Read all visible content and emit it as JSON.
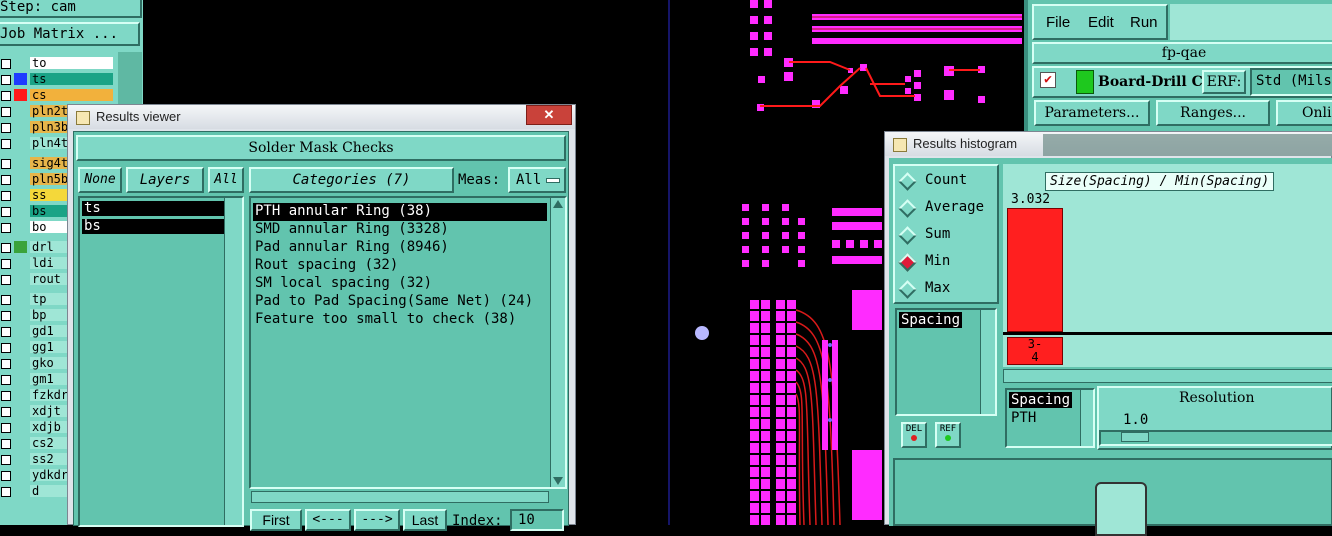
{
  "step_label": "Step: cam",
  "job_matrix_button": "Job Matrix ...",
  "layers": [
    {
      "name": "to",
      "color": "#ffffff",
      "swatch": ""
    },
    {
      "name": "ts",
      "color": "#1aa386",
      "swatch": "#1f3cff"
    },
    {
      "name": "cs",
      "color": "#f2b13c",
      "swatch": "#ff1a1a"
    },
    {
      "name": "pln2t",
      "color": "#e6b54a",
      "swatch": ""
    },
    {
      "name": "pln3b",
      "color": "#e6b54a",
      "swatch": ""
    },
    {
      "name": "pln4t",
      "color": "#9fe6d6",
      "swatch": ""
    },
    {
      "name": "sig4t",
      "color": "#e6b54a",
      "swatch": ""
    },
    {
      "name": "pln5b",
      "color": "#e6b54a",
      "swatch": ""
    },
    {
      "name": "ss",
      "color": "#f4d83a",
      "swatch": ""
    },
    {
      "name": "bs",
      "color": "#1aa386",
      "swatch": ""
    },
    {
      "name": "bo",
      "color": "#ffffff",
      "swatch": ""
    },
    {
      "name": "drl",
      "color": "#9fe6d6",
      "swatch": "#3aa33a"
    },
    {
      "name": "ldi",
      "color": "#9fe6d6",
      "swatch": ""
    },
    {
      "name": "rout",
      "color": "#9fe6d6",
      "swatch": ""
    },
    {
      "name": "tp",
      "color": "#9fe6d6",
      "swatch": ""
    },
    {
      "name": "bp",
      "color": "#9fe6d6",
      "swatch": ""
    },
    {
      "name": "gd1",
      "color": "#9fe6d6",
      "swatch": ""
    },
    {
      "name": "gg1",
      "color": "#9fe6d6",
      "swatch": ""
    },
    {
      "name": "gko",
      "color": "#9fe6d6",
      "swatch": ""
    },
    {
      "name": "gm1",
      "color": "#9fe6d6",
      "swatch": ""
    },
    {
      "name": "fzkdr",
      "color": "#9fe6d6",
      "swatch": ""
    },
    {
      "name": "xdjt",
      "color": "#9fe6d6",
      "swatch": ""
    },
    {
      "name": "xdjb",
      "color": "#9fe6d6",
      "swatch": ""
    },
    {
      "name": "cs2",
      "color": "#9fe6d6",
      "swatch": ""
    },
    {
      "name": "ss2",
      "color": "#9fe6d6",
      "swatch": ""
    },
    {
      "name": "ydkdr",
      "color": "#9fe6d6",
      "swatch": ""
    },
    {
      "name": "d",
      "color": "#9fe6d6",
      "swatch": ""
    }
  ],
  "results_viewer": {
    "title": "Results viewer",
    "heading": "Solder Mask Checks",
    "none_btn": "None",
    "layers_btn": "Layers",
    "all_btn": "All",
    "categories_btn": "Categories (7)",
    "meas_label": "Meas:",
    "meas_value": "All",
    "layer_list": [
      "ts",
      "bs"
    ],
    "categories": [
      "PTH annular Ring (38)",
      "SMD annular Ring (3328)",
      "Pad annular Ring (8946)",
      "Rout spacing (32)",
      "SM local spacing (32)",
      "Pad to Pad Spacing(Same Net) (24)",
      "Feature too small to check (38)"
    ],
    "first_btn": "First",
    "prev_btn": "<---",
    "next_btn": "--->",
    "last_btn": "Last",
    "index_label": "Index:",
    "index_value": "10"
  },
  "qae": {
    "menu": [
      "File",
      "Edit",
      "Run"
    ],
    "title": "fp-qae",
    "check_name": "Board-Drill Che",
    "erf_label": "ERF:",
    "erf_value": "Std (Mils",
    "parameters_btn": "Parameters...",
    "ranges_btn": "Ranges...",
    "online_btn": "Onli"
  },
  "histogram": {
    "title": "Results histogram",
    "modes": [
      "Count",
      "Average",
      "Sum",
      "Min",
      "Max"
    ],
    "selected_mode": "Min",
    "chart_title": "Size(Spacing) / Min(Spacing)",
    "bar_value": "3.032",
    "bar_label_line1": "3-",
    "bar_label_line2": "4",
    "list_item": "Spacing",
    "del_btn": "DEL",
    "ref_btn": "REF",
    "lower_list": [
      "Spacing",
      "PTH"
    ],
    "resolution_label": "Resolution",
    "resolution_value": "1.0"
  }
}
